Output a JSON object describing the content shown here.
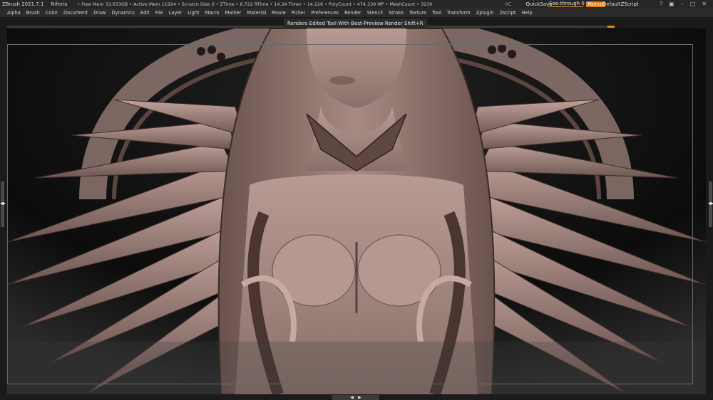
{
  "titlebar": {
    "app": "ZBrush 2021.7.1",
    "document": "Niferia",
    "stats": "• Free Mem 33.633GB • Active Mem 11924 • Scratch Disk 0 • ZTime • 6.722 RTime • 14.34 Timer • 14.226 • PolyCount • 474.339 MP • MeshCount • 3230",
    "ac": "AC",
    "quicksave": "QuickSave",
    "see_through": "See-through  0",
    "menus": "Menus",
    "zscript": "DefaultZScript",
    "icons": [
      "help-icon",
      "layout-icon",
      "minimize-icon",
      "maximize-icon",
      "close-icon"
    ]
  },
  "menubar": {
    "items": [
      "Alpha",
      "Brush",
      "Color",
      "Document",
      "Draw",
      "Dynamics",
      "Edit",
      "File",
      "Layer",
      "Light",
      "Macro",
      "Marker",
      "Material",
      "Movie",
      "Picker",
      "Preferences",
      "Render",
      "Stencil",
      "Stroke",
      "Texture",
      "Tool",
      "Transform",
      "Zplugin",
      "Zscript",
      "Help"
    ]
  },
  "tooltip": {
    "text": "Renders Edited Tool With Best-Preview Render  Shift+R"
  },
  "colors": {
    "accent": "#e07d14",
    "titlebar_bg": "#262626",
    "menubar_bg": "#2b2b2b",
    "viewport_bg": "#0b0b0b",
    "sculpt_base": "#a88c86",
    "sculpt_shadow": "#4a3632"
  },
  "handles": {
    "left_arrow": "◂▸",
    "right_arrow": "◂▸",
    "bottom_left": "◀",
    "bottom_right": "▶"
  }
}
